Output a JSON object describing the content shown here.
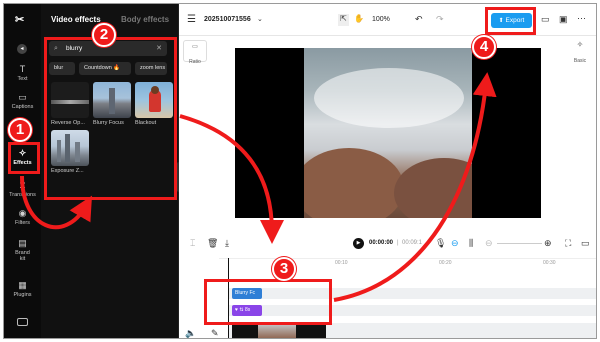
{
  "sidebar": {
    "items": [
      {
        "label": "Text",
        "icon": "text-icon"
      },
      {
        "label": "Captions",
        "icon": "captions-icon"
      },
      {
        "label": "Effects",
        "icon": "effects-icon"
      },
      {
        "label": "Transitions",
        "icon": "transitions-icon"
      },
      {
        "label": "Filters",
        "icon": "filters-icon"
      },
      {
        "label": "Brand kit",
        "icon": "brand-kit-icon"
      },
      {
        "label": "Plugins",
        "icon": "plugins-icon"
      }
    ]
  },
  "panel": {
    "tabs": [
      "Video effects",
      "Body effects"
    ],
    "search_value": "blurry",
    "chips": [
      "blur",
      "Countdown 🔥",
      "zoom lens"
    ],
    "effects": [
      {
        "label": "Reverse Op..."
      },
      {
        "label": "Blurry Focus"
      },
      {
        "label": "Blackout"
      },
      {
        "label": "Exposure Z..."
      }
    ]
  },
  "topbar": {
    "project_name": "202510071556",
    "zoom": "100%",
    "export_label": "Export"
  },
  "canvas": {
    "ratio_label": "Ratio",
    "basic_label": "Basic"
  },
  "timeline": {
    "current_time": "00:00:00",
    "total_time": "00:09:1",
    "ruler": [
      "00:10",
      "00:20",
      "00:30"
    ],
    "effect_clip": "Blurry Fc",
    "filter_clip": "8s"
  },
  "annotations": [
    "1",
    "2",
    "3",
    "4"
  ],
  "colors": {
    "accent": "#1a9cf0",
    "annotation": "#ef1b1b",
    "effect_clip": "#2f7fd6",
    "filter_clip": "#8a45e8"
  }
}
